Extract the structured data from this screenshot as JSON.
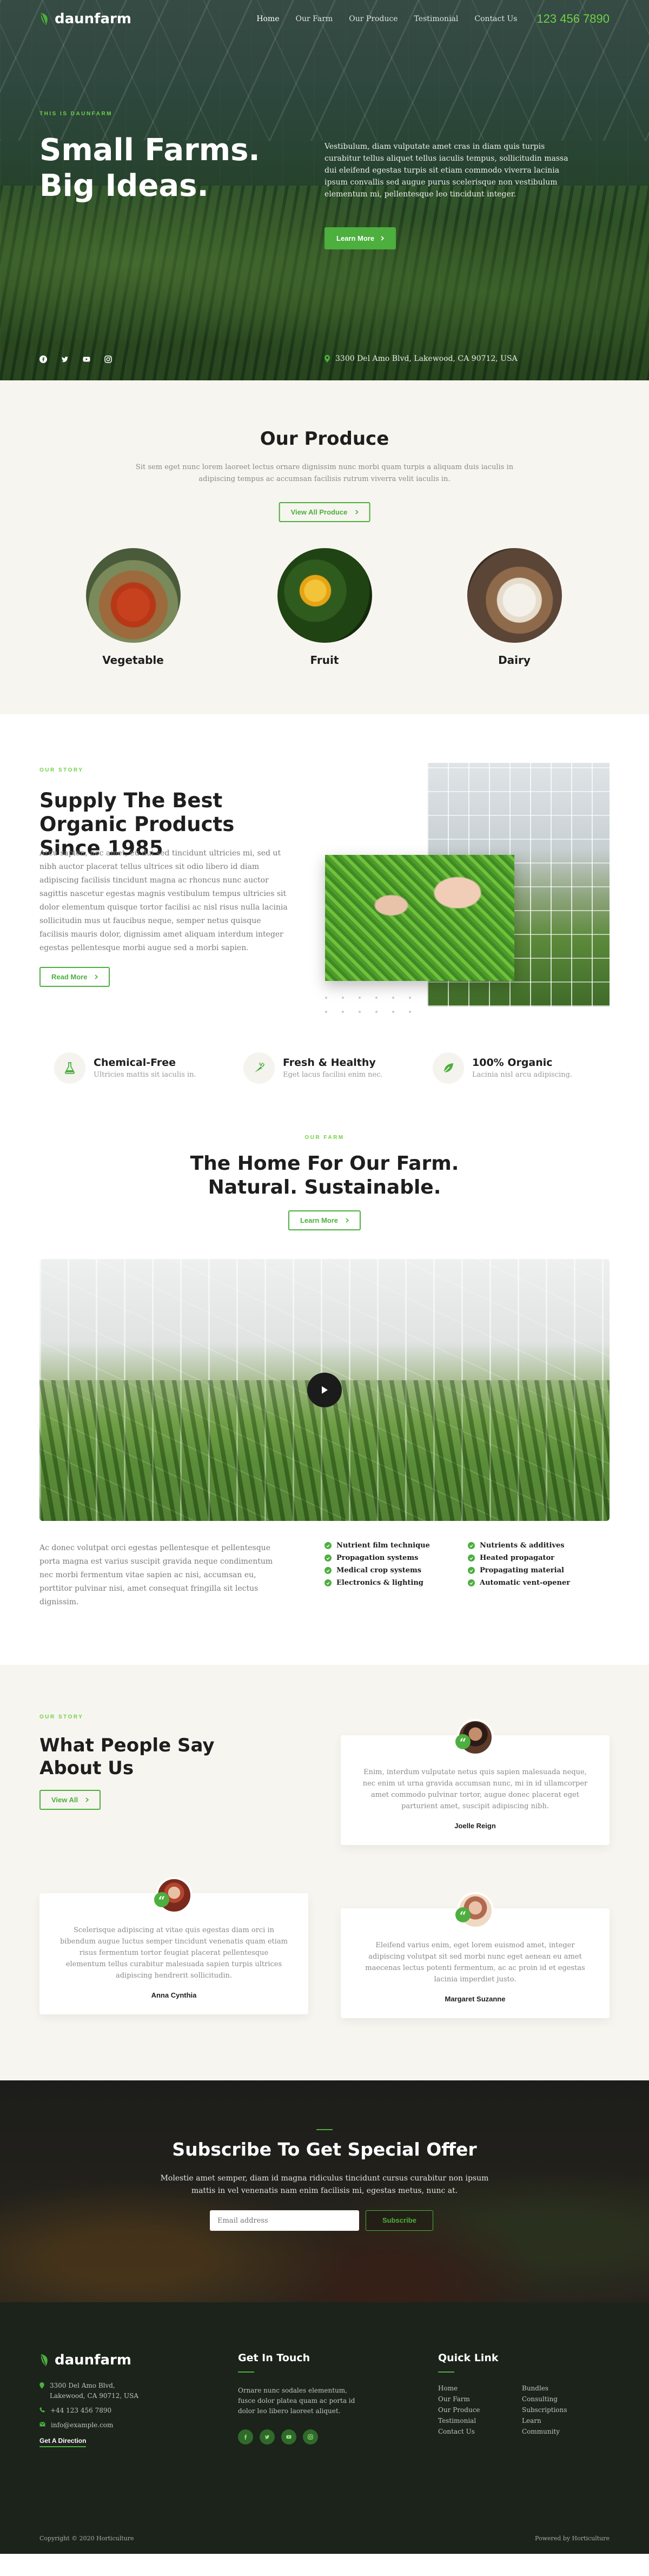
{
  "nav": {
    "logo": "daunfarm",
    "items": [
      "Home",
      "Our Farm",
      "Our Produce",
      "Testimonial",
      "Contact Us"
    ],
    "phone": "123 456 7890"
  },
  "hero": {
    "eyebrow": "THIS IS DAUNFARM",
    "title_line1": "Small Farms.",
    "title_line2": "Big Ideas.",
    "lead": "Vestibulum, diam vulputate amet cras in diam quis turpis curabitur tellus aliquet tellus iaculis tempus, sollicitudin massa dui eleifend egestas turpis sit etiam commodo viverra lacinia ipsum convallis sed augue purus scelerisque non vestibulum elementum mi, pellentesque leo tincidunt integer.",
    "button": "Learn More",
    "address": "3300 Del Amo Blvd, Lakewood, CA 90712, USA"
  },
  "produce": {
    "title": "Our Produce",
    "sub": "Sit sem eget nunc lorem laoreet lectus ornare dignissim nunc morbi quam turpis a aliquam duis iaculis in adipiscing tempus ac accumsan facilisis rutrum viverra velit iaculis in.",
    "button": "View All Produce",
    "items": [
      {
        "name": "Vegetable"
      },
      {
        "name": "Fruit"
      },
      {
        "name": "Dairy"
      }
    ]
  },
  "supply": {
    "eyebrow": "OUR STORY",
    "title": "Supply The Best Organic Products Since 1985",
    "body": "Arcu sapien, nec amet, eu dui sed tincidunt ultricies mi, sed ut nibh auctor placerat tellus ultrices sit odio libero id diam adipiscing facilisis tincidunt magna ac rhoncus nunc auctor sagittis nascetur egestas magnis vestibulum tempus ultricies sit dolor elementum quisque tortor facilisi ac nisl risus nulla lacinia sollicitudin mus ut faucibus neque, semper netus quisque facilisis mauris dolor, dignissim amet aliquam interdum integer egestas pellentesque morbi augue sed a morbi sapien.",
    "button": "Read More"
  },
  "features": [
    {
      "title": "Chemical-Free",
      "desc": "Ultricies mattis sit iaculis in."
    },
    {
      "title": "Fresh & Healthy",
      "desc": "Eget lacus facilisi enim nec."
    },
    {
      "title": "100% Organic",
      "desc": "Lacinia nisl arcu adipiscing."
    }
  ],
  "home": {
    "eyebrow": "OUR FARM",
    "title_line1": "The Home For Our Farm.",
    "title_line2": "Natural. Sustainable.",
    "button": "Learn More",
    "para": "Ac donec volutpat orci egestas pellentesque et pellentesque porta magna est varius suscipit gravida neque condimentum nec morbi fermentum vitae sapien ac nisi, accumsan eu, porttitor pulvinar nisi, amet consequat fringilla sit lectus dignissim.",
    "checks_a": [
      "Nutrient film technique",
      "Propagation systems",
      "Medical crop systems",
      "Electronics & lighting"
    ],
    "checks_b": [
      "Nutrients & additives",
      "Heated propagator",
      "Propagating material",
      "Automatic vent-opener"
    ]
  },
  "testimonials": {
    "eyebrow": "OUR STORY",
    "title": "What People Say About Us",
    "button": "View All",
    "cards": [
      {
        "quote": "Enim, interdum vulputate netus quis sapien malesuada neque, nec enim ut urna gravida accumsan nunc, mi in id ullamcorper amet commodo pulvinar tortor, augue donec placerat eget parturient amet, suscipit adipiscing nibh.",
        "name": "Joelle Reign"
      },
      {
        "quote": "Scelerisque adipiscing at vitae quis egestas diam orci in bibendum augue luctus semper tincidunt venenatis quam etiam risus fermentum tortor feugiat placerat pellentesque elementum tellus curabitur malesuada sapien turpis ultrices adipiscing hendrerit sollicitudin.",
        "name": "Anna Cynthia"
      },
      {
        "quote": "Eleifend varius enim, eget lorem euismod amet, integer adipiscing volutpat sit sed morbi nunc eget aenean eu amet maecenas lectus potenti fermentum, ac ac proin id et egestas lacinia imperdiet justo.",
        "name": "Margaret Suzanne"
      }
    ]
  },
  "subscribe": {
    "title": "Subscribe To Get Special Offer",
    "sub": "Molestie amet semper, diam id magna ridiculus tincidunt cursus curabitur non ipsum mattis in vel venenatis nam enim facilisis mi, egestas metus, nunc at.",
    "placeholder": "Email address",
    "button": "Subscribe"
  },
  "footer": {
    "logo": "daunfarm",
    "address": "3300 Del Amo Blvd, Lakewood, CA 90712, USA",
    "phone": "+44 123 456 7890",
    "email": "info@example.com",
    "direction": "Get A Direction",
    "touch_title": "Get In Touch",
    "touch_text": "Ornare nunc sodales elementum, fusce dolor platea quam ac porta id dolor leo libero laoreet aliquet.",
    "links_title": "Quick Link",
    "links_a": [
      "Home",
      "Our Farm",
      "Our Produce",
      "Testimonial",
      "Contact Us"
    ],
    "links_b": [
      "Bundles",
      "Consulting",
      "Subscriptions",
      "Learn",
      "Community"
    ],
    "copyright": "Copyright © 2020 Horticulture",
    "powered": "Powered by Horticulture"
  },
  "colors": {
    "accent": "#4caf3e",
    "phone": "#6fd146",
    "dark": "#1b231b",
    "cream": "#f7f5ef"
  }
}
